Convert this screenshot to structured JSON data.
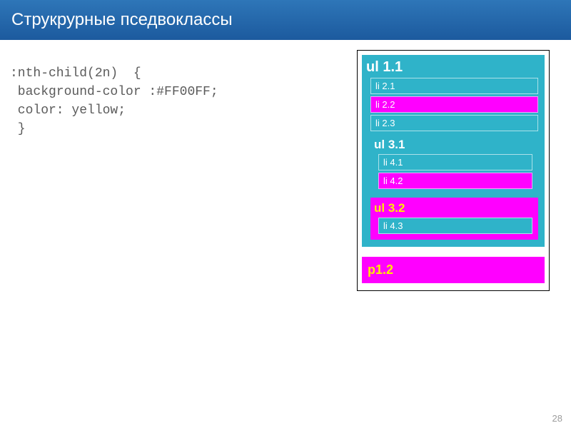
{
  "title": "Струкрурные пседвоклассы",
  "code": {
    "l1": ":nth-child(2n)  {",
    "l2": " background-color :#FF00FF;",
    "l3": " color: yellow;",
    "l4": " }"
  },
  "demo": {
    "ul1": {
      "label": "ul 1.1",
      "li21": "li 2.1",
      "li22": "li 2.2",
      "li23": "li 2.3",
      "ul31": {
        "label": "ul 3.1",
        "li41": "li 4.1",
        "li42": "li 4.2"
      },
      "ul32": {
        "label": "ul 3.2",
        "li43": "li 4.3"
      }
    },
    "p12": "p1.2"
  },
  "page_number": "28",
  "colors": {
    "cyan": "#2fb3c9",
    "magenta": "#ff00ff",
    "yellow": "#ffeb00",
    "header_gradient_top": "#2e76b8",
    "header_gradient_bottom": "#1c5a9e"
  }
}
